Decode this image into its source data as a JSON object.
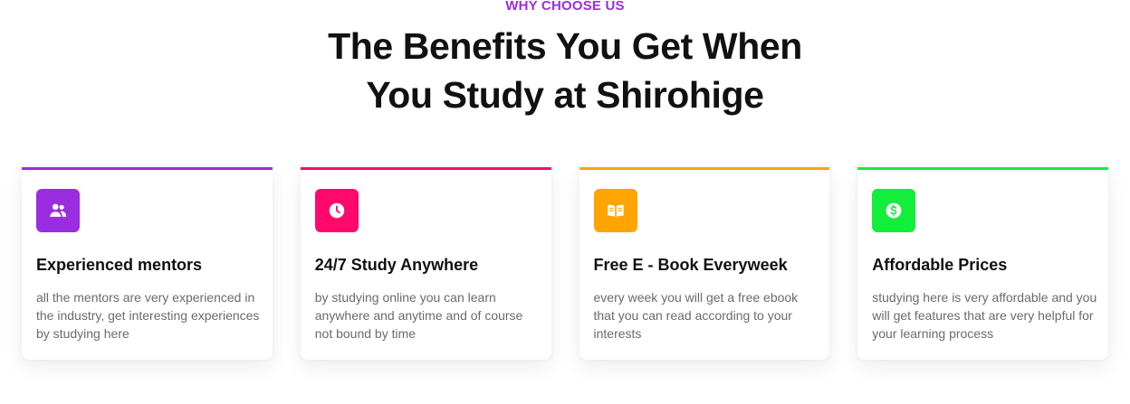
{
  "section": {
    "eyebrow": "WHY CHOOSE US",
    "headline_line1": "The Benefits You Get When",
    "headline_line2": "You Study at Shirohige",
    "eyebrow_color": "#9b2de0"
  },
  "cards": [
    {
      "title": "Experienced mentors",
      "description": "all the mentors are very experienced in the industry, get interesting experiences by studying here",
      "icon": "users-icon",
      "accent": "#9b2de0"
    },
    {
      "title": "24/7 Study Anywhere",
      "description": "by studying online you can learn anywhere and anytime and of course not bound by time",
      "icon": "clock-icon",
      "accent": "#ff0a6c"
    },
    {
      "title": "Free E - Book Everyweek",
      "description": "every week you will get a free ebook that you can read according to your interests",
      "icon": "book-icon",
      "accent": "#ffa400"
    },
    {
      "title": "Affordable Prices",
      "description": "studying here is very affordable and you will get features that are very helpful for your learning process",
      "icon": "dollar-icon",
      "accent": "#12ee3a"
    }
  ]
}
